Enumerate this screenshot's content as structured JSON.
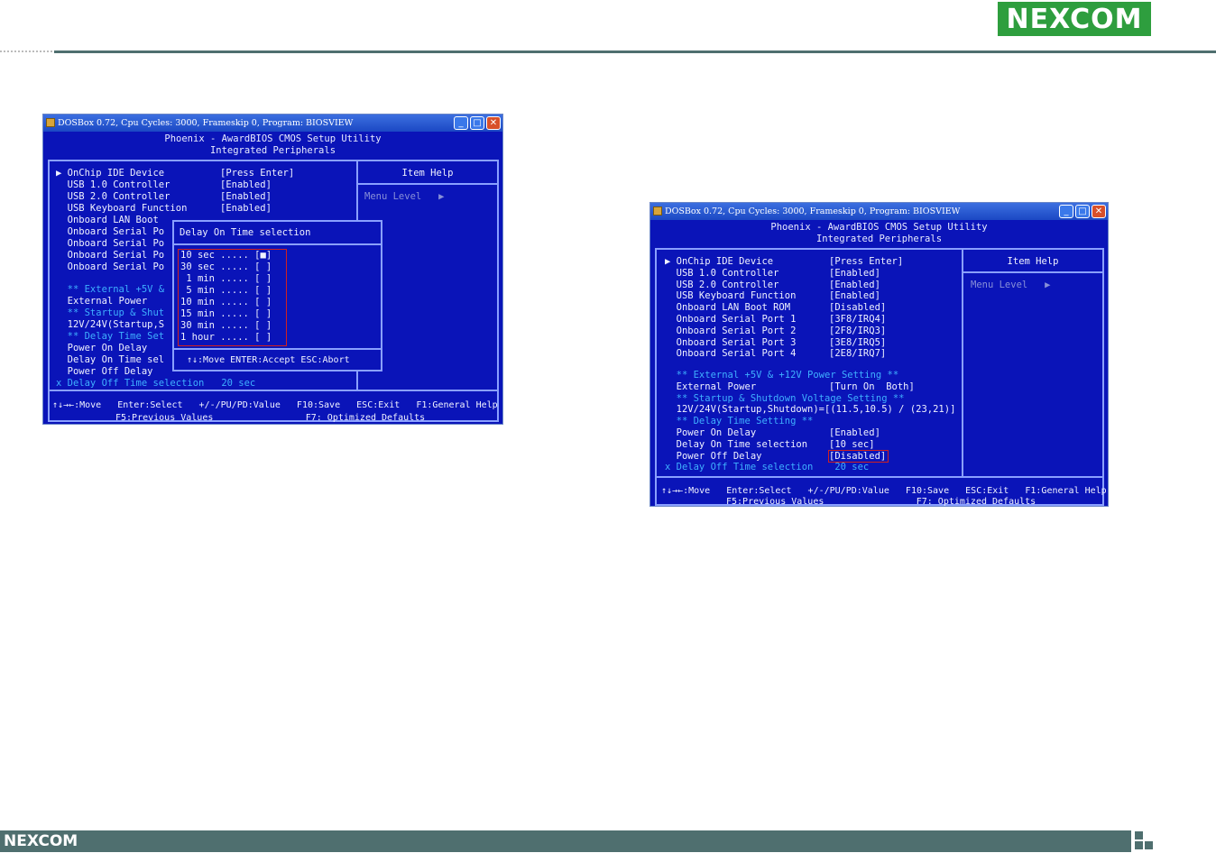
{
  "header": {
    "logo": "NEXCOM"
  },
  "footer": {
    "logo": "NEXCOM"
  },
  "left_window": {
    "title": "DOSBox 0.72, Cpu Cycles:    3000, Frameskip  0, Program:  BIOSVIEW",
    "heading1": "Phoenix - AwardBIOS CMOS Setup Utility",
    "heading2": "Integrated Peripherals",
    "items": [
      {
        "label": "▶ OnChip IDE Device",
        "value": "[Press Enter]"
      },
      {
        "label": "  USB 1.0 Controller",
        "value": "[Enabled]"
      },
      {
        "label": "  USB 2.0 Controller",
        "value": "[Enabled]"
      },
      {
        "label": "  USB Keyboard Function",
        "value": "[Enabled]"
      },
      {
        "label": "  Onboard LAN Boot",
        "value": ""
      },
      {
        "label": "  Onboard Serial Po",
        "value": ""
      },
      {
        "label": "  Onboard Serial Po",
        "value": ""
      },
      {
        "label": "  Onboard Serial Po",
        "value": ""
      },
      {
        "label": "  Onboard Serial Po",
        "value": ""
      }
    ],
    "lower_items": [
      {
        "label": "  ** External +5V &",
        "style": "c"
      },
      {
        "label": "  External Power",
        "style": "w"
      },
      {
        "label": "  ** Startup & Shut",
        "style": "c"
      },
      {
        "label": "  12V/24V(Startup,S",
        "style": "w"
      },
      {
        "label": "  ** Delay Time Set",
        "style": "c"
      },
      {
        "label": "  Power On Delay",
        "style": "w"
      },
      {
        "label": "  Delay On Time sel",
        "style": "w"
      },
      {
        "label": "  Power Off Delay",
        "style": "w"
      },
      {
        "label": "x Delay Off Time selection   20 sec",
        "style": "c"
      }
    ],
    "help_title": "Item Help",
    "help_level": "Menu Level   ▶",
    "popup": {
      "title": "Delay On Time selection",
      "options": [
        "10 sec ..... [■]",
        "30 sec ..... [ ]",
        " 1 min ..... [ ]",
        " 5 min ..... [ ]",
        "10 min ..... [ ]",
        "15 min ..... [ ]",
        "30 min ..... [ ]",
        "1 hour ..... [ ]"
      ],
      "footer": "↑↓:Move ENTER:Accept ESC:Abort"
    },
    "keys1": "↑↓→←:Move   Enter:Select   +/-/PU/PD:Value   F10:Save   ESC:Exit   F1:General Help",
    "keys2": "F5:Previous Values                 F7: Optimized Defaults"
  },
  "right_window": {
    "title": "DOSBox 0.72, Cpu Cycles:    3000, Frameskip  0, Program:  BIOSVIEW",
    "heading1": "Phoenix - AwardBIOS CMOS Setup Utility",
    "heading2": "Integrated Peripherals",
    "items": [
      {
        "label": "▶ OnChip IDE Device",
        "value": "[Press Enter]",
        "style": "w"
      },
      {
        "label": "  USB 1.0 Controller",
        "value": "[Enabled]",
        "style": "w"
      },
      {
        "label": "  USB 2.0 Controller",
        "value": "[Enabled]",
        "style": "w"
      },
      {
        "label": "  USB Keyboard Function",
        "value": "[Enabled]",
        "style": "w"
      },
      {
        "label": "  Onboard LAN Boot ROM",
        "value": "[Disabled]",
        "style": "w"
      },
      {
        "label": "  Onboard Serial Port 1",
        "value": "[3F8/IRQ4]",
        "style": "w"
      },
      {
        "label": "  Onboard Serial Port 2",
        "value": "[2F8/IRQ3]",
        "style": "w"
      },
      {
        "label": "  Onboard Serial Port 3",
        "value": "[3E8/IRQ5]",
        "style": "w"
      },
      {
        "label": "  Onboard Serial Port 4",
        "value": "[2E8/IRQ7]",
        "style": "w"
      }
    ],
    "lower_items": [
      {
        "label": "  ** External +5V & +12V Power Setting **",
        "value": "",
        "style": "c"
      },
      {
        "label": "  External Power",
        "value": "[Turn On  Both]",
        "style": "w"
      },
      {
        "label": "  ** Startup & Shutdown Voltage Setting **",
        "value": "",
        "style": "c"
      },
      {
        "label": "  12V/24V(Startup,Shutdown)=[(11.5,10.5) / (23,21)]",
        "value": "",
        "style": "w"
      },
      {
        "label": "  ** Delay Time Setting **",
        "value": "",
        "style": "c"
      },
      {
        "label": "  Power On Delay",
        "value": "[Enabled]",
        "style": "w"
      },
      {
        "label": "  Delay On Time selection",
        "value": "[10 sec]",
        "style": "w"
      },
      {
        "label": "  Power Off Delay",
        "value": "[Disabled]",
        "style": "w"
      },
      {
        "label": "x Delay Off Time selection",
        "value": " 20 sec",
        "style": "c"
      }
    ],
    "help_title": "Item Help",
    "help_level": "Menu Level   ▶",
    "keys1": "↑↓→←:Move   Enter:Select   +/-/PU/PD:Value   F10:Save   ESC:Exit   F1:General Help",
    "keys2": "F5:Previous Values                 F7: Optimized Defaults"
  },
  "colors": {
    "brand_green": "#2e9e3e",
    "bios_blue": "#0a14b8",
    "bar_gray": "#4f6f6f",
    "highlight_red": "#d02020"
  }
}
